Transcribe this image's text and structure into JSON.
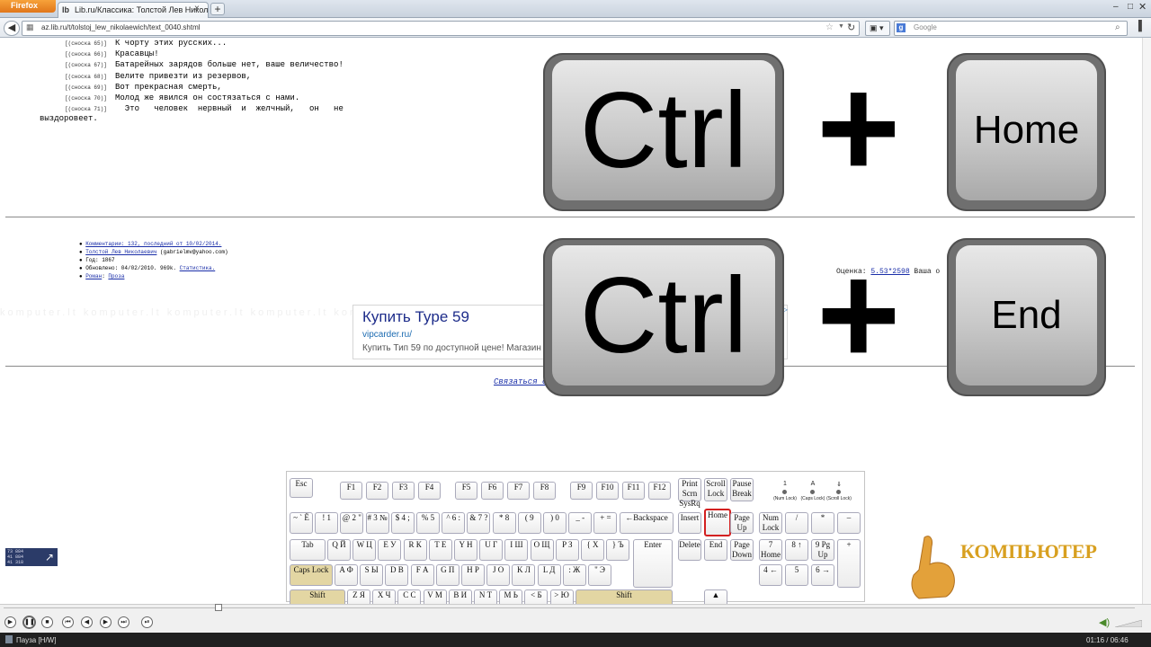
{
  "browser": {
    "app_button": "Firefox",
    "tab_title": "Lib.ru/Классика: Толстой Лев Николае...",
    "tab_close": "×",
    "new_tab": "+",
    "url": "az.lib.ru/t/tolstoj_lew_nikolaewich/text_0040.shtml",
    "search_placeholder": "Google",
    "window_controls": {
      "minimize": "–",
      "maximize": "□",
      "close": "✕"
    }
  },
  "page": {
    "footnotes": [
      {
        "ref": "[(сноска 65)]",
        "text": "К чорту этих русских..."
      },
      {
        "ref": "[(сноска 66)]",
        "text": "Красавцы!"
      },
      {
        "ref": "[(сноска 67)]",
        "text": "Батарейных зарядов больше нет, ваше величество!"
      },
      {
        "ref": "[(сноска 68)]",
        "text": "Велите привезти из резервов,"
      },
      {
        "ref": "[(сноска 69)]",
        "text": "Вот прекрасная смерть,"
      },
      {
        "ref": "[(сноска 70)]",
        "text": "Молод же явился он состязаться с нами."
      },
      {
        "ref": "[(сноска 71)]",
        "text": "  Это   человек  нервный  и  желчный,   он   не"
      }
    ],
    "footnote_tail": "выздоровеет.",
    "info_list": [
      {
        "text": "Комментарии: 132, последний от 10/02/2014.",
        "link": true
      },
      {
        "text": "Толстой Лев Николаевич",
        "link": true,
        "suffix": " (gabrielmv@yahoo.com)"
      },
      {
        "text": "Год: 1867",
        "link": false
      },
      {
        "text": "Обновлено: 04/02/2010. 969k. ",
        "link": false,
        "suffix_link": "Статистика."
      },
      {
        "text": "Роман",
        "link": true,
        "suffix_link": "Проза"
      }
    ],
    "rating_label": "Оценка: ",
    "rating_value": "5.53*2598",
    "rating_tail": "  Ваша о",
    "ad": {
      "title": "Купить Type 59",
      "url": "vipcarder.ru/",
      "description": "Купить Тип 59 по доступной цене! Магазин W",
      "info": "i▷"
    },
    "contact_link": "Связаться с",
    "watermark": "komputer.lt komputer.lt komputer.lt komputer.lt komputer.lt komputer.lt komputer.lt komputer.lt komputer.lt"
  },
  "overlay": {
    "row1": {
      "key1": "Ctrl",
      "plus": "+",
      "key2": "Home"
    },
    "row2": {
      "key1": "Ctrl",
      "plus": "+",
      "key2": "End"
    }
  },
  "keyboard": {
    "esc": "Esc",
    "fkeys": [
      "F1",
      "F2",
      "F3",
      "F4",
      "F5",
      "F6",
      "F7",
      "F8",
      "F9",
      "F10",
      "F11",
      "F12"
    ],
    "print": "Print Scrn SysRq",
    "scroll": "Scroll Lock",
    "pause": "Pause Break",
    "leds": [
      {
        "num": "1",
        "label": "(Num Lock)"
      },
      {
        "num": "A",
        "label": "(Caps Lock)"
      },
      {
        "num": "⇓",
        "label": "(Scroll Lock)"
      }
    ],
    "row_num": [
      "~ ` Ё",
      "! 1",
      "@ 2 \"",
      "# 3 №",
      "$ 4 ;",
      "% 5",
      "^ 6 :",
      "& 7 ?",
      "* 8",
      "( 9",
      ") 0",
      "_ -",
      "+ ="
    ],
    "backspace": "←Backspace",
    "insert": "Insert",
    "home": "Home",
    "pageup": "Page Up",
    "numlock": "Num Lock",
    "num_slash": "/",
    "num_star": "*",
    "num_minus": "–",
    "tab": "Tab",
    "row_q": [
      "Q Й",
      "W Ц",
      "E У",
      "R К",
      "T Е",
      "Y Н",
      "U Г",
      "I Ш",
      "O Щ",
      "P З",
      "{ Х",
      "} Ъ"
    ],
    "enter": "Enter",
    "delete": "Delete",
    "end": "End",
    "pagedown": "Page Down",
    "num7": "7 Home",
    "num8": "8 ↑",
    "num9": "9 Pg Up",
    "num_plus": "+",
    "caps": "Caps Lock",
    "row_a": [
      "A Ф",
      "S Ы",
      "D В",
      "F А",
      "G П",
      "H Р",
      "J О",
      "K Л",
      "L Д",
      ": Ж",
      "\" Э"
    ],
    "num4": "4 ←",
    "num5": "5",
    "num6": "6 →",
    "shift": "Shift",
    "row_z": [
      "Z Я",
      "X Ч",
      "C С",
      "V М",
      "B И",
      "N Т",
      "M Ь",
      "< Б",
      "> Ю"
    ],
    "up_arrow": "▲"
  },
  "logo_text": "КОМПЬЮТЕР",
  "osd_text": "73 884\n41 884\n41 318",
  "media": {
    "status": "Пауза [H/W]",
    "time": "01:16 / 06:46"
  }
}
